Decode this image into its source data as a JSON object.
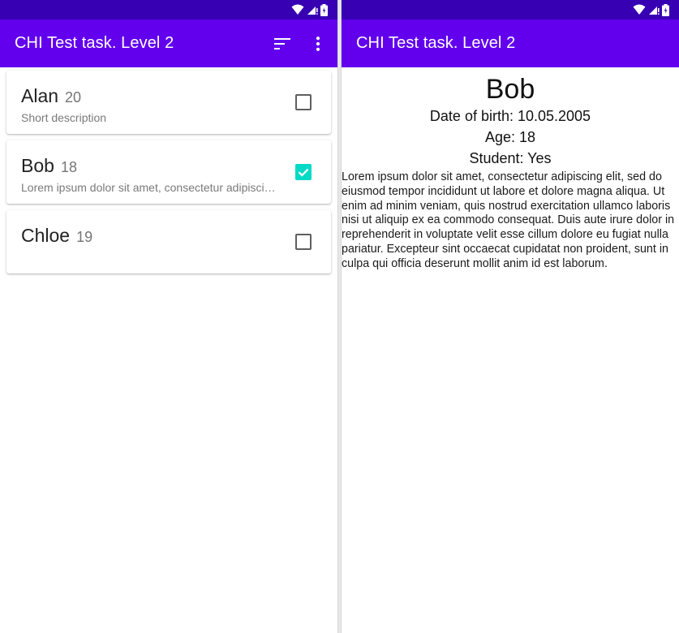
{
  "app": {
    "title": "CHI Test task. Level 2",
    "colors": {
      "primary": "#6200ee",
      "primary_dark": "#3700b3",
      "accent": "#03dac5"
    }
  },
  "left_screen": {
    "toolbar": {
      "sort_icon": "sort-icon",
      "menu_icon": "more-vert-icon"
    },
    "students": [
      {
        "name": "Alan",
        "age": "20",
        "description": "Short description",
        "checked": false
      },
      {
        "name": "Bob",
        "age": "18",
        "description": "Lorem ipsum dolor sit amet, consectetur adipiscing elit, sed do eiusmod tempor",
        "checked": true
      },
      {
        "name": "Chloe",
        "age": "19",
        "description": "",
        "checked": false
      }
    ]
  },
  "right_screen": {
    "name": "Bob",
    "date_of_birth": "Date of birth: 10.05.2005",
    "age": "Age: 18",
    "student": "Student: Yes",
    "bio": "Lorem ipsum dolor sit amet, consectetur adipiscing elit, sed do eiusmod tempor incididunt ut labore et dolore magna aliqua. Ut enim ad minim veniam, quis nostrud exercitation ullamco laboris nisi ut aliquip ex ea commodo consequat. Duis aute irure dolor in reprehenderit in voluptate velit esse cillum dolore eu fugiat nulla pariatur. Excepteur sint occaecat cupidatat non proident, sunt in culpa qui officia deserunt mollit anim id est laborum."
  }
}
